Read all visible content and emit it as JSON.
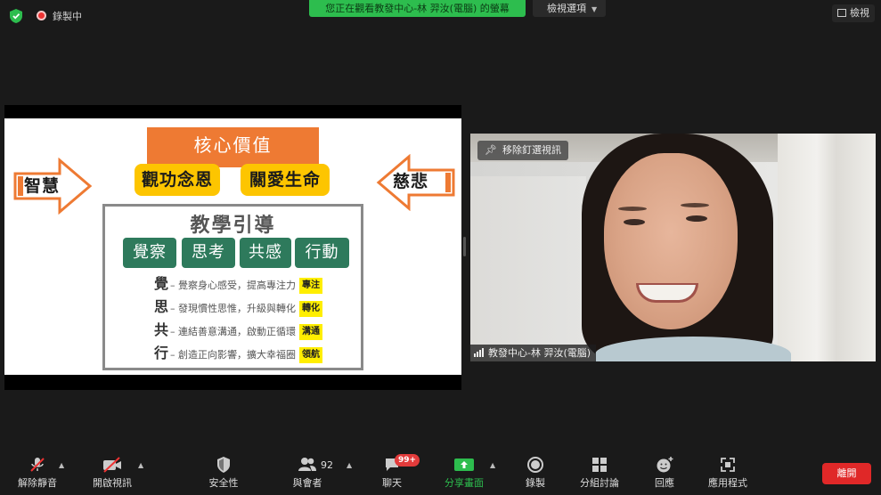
{
  "topbar": {
    "recording_label": "錄製中",
    "viewing_banner": "您正在觀看教發中心-林 羿汝(電腦) 的螢幕",
    "view_options": "檢視選項",
    "gallery_label": "檢視"
  },
  "slide": {
    "core_title": "核心價值",
    "value_left": "觀功念恩",
    "value_right": "關愛生命",
    "arrow_left_label": "智慧",
    "arrow_right_label": "慈悲",
    "guide_title": "教學引導",
    "tags": [
      "覺察",
      "思考",
      "共感",
      "行動"
    ],
    "rows": [
      {
        "head": "覺",
        "text": "– 覺察身心感受，提高專注力",
        "keyword": "專注"
      },
      {
        "head": "思",
        "text": "– 發現慣性思惟，升級與轉化",
        "keyword": "轉化"
      },
      {
        "head": "共",
        "text": "– 連結善意溝通，啟動正循環",
        "keyword": "溝通"
      },
      {
        "head": "行",
        "text": "– 創造正向影響，擴大幸福圈",
        "keyword": "領航"
      }
    ]
  },
  "video": {
    "unpin_label": "移除釘選視訊",
    "participant_name": "教發中心-林 羿汝(電腦)"
  },
  "toolbar": {
    "mute_label": "解除靜音",
    "video_label": "開啟視訊",
    "security_label": "安全性",
    "participants_label": "與會者",
    "participants_count": "92",
    "chat_label": "聊天",
    "chat_badge": "99+",
    "share_label": "分享畫面",
    "record_label": "錄製",
    "breakout_label": "分組討論",
    "reactions_label": "回應",
    "apps_label": "應用程式",
    "leave_label": "離開"
  },
  "colors": {
    "banner_green": "#2dbd4e",
    "slide_orange": "#ee7a33",
    "slide_yellow": "#fdc500",
    "tag_green": "#2e7a5c",
    "leave_red": "#e02828",
    "share_green": "#2dbd4e"
  },
  "icons": {
    "security": "shield-icon",
    "recording": "record-dot-icon",
    "mute": "microphone-muted-icon",
    "video": "video-off-icon",
    "participants": "people-icon",
    "chat": "chat-bubble-icon",
    "share": "share-screen-icon",
    "record": "record-icon",
    "breakout": "grid-icon",
    "reactions": "smiley-plus-icon",
    "apps": "apps-icon",
    "pin": "pin-icon"
  }
}
